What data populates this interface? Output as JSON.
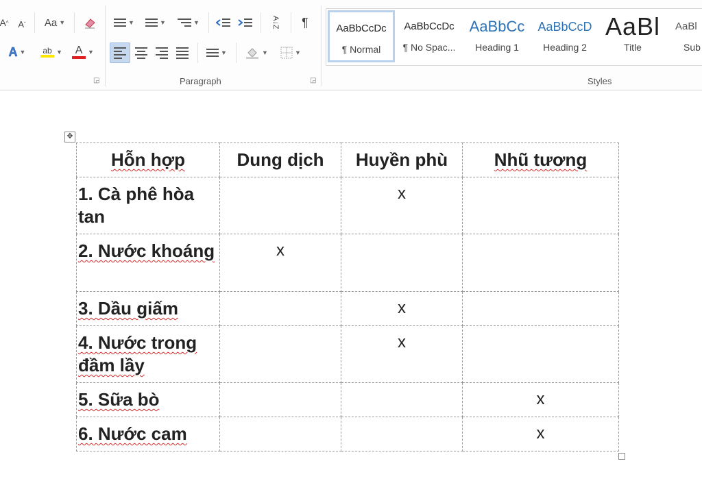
{
  "ribbon": {
    "font_case_label": "Aa",
    "paragraph_label": "Paragraph",
    "styles_label": "Styles",
    "pilcrow": "¶",
    "sort_label": "A↓Z",
    "styles": [
      {
        "preview": "AaBbCcDc",
        "name": "¶ Normal",
        "selected": true
      },
      {
        "preview": "AaBbCcDc",
        "name": "¶ No Spac...",
        "selected": false
      },
      {
        "preview": "AaBbCc",
        "name": "Heading 1",
        "selected": false
      },
      {
        "preview": "AaBbCcD",
        "name": "Heading 2",
        "selected": false
      },
      {
        "preview": "AaBl",
        "name": "Title",
        "selected": false
      },
      {
        "preview": "AaBl",
        "name": "Sub",
        "selected": false
      }
    ],
    "colors": {
      "highlight": "#ffe600",
      "font_color": "#e02020",
      "accent": "#2b579a"
    }
  },
  "table": {
    "headers": [
      "Hỗn hợp",
      "Dung dịch",
      "Huyền phù",
      "Nhũ tương"
    ],
    "rows": [
      {
        "name": "1. Cà phê hòa tan",
        "dung_dich": "",
        "huyen_phu": "x",
        "nhu_tuong": ""
      },
      {
        "name": "2. Nước khoáng",
        "dung_dich": "x",
        "huyen_phu": "",
        "nhu_tuong": ""
      },
      {
        "name": "3. Dầu giấm",
        "dung_dich": "",
        "huyen_phu": "x",
        "nhu_tuong": ""
      },
      {
        "name": "4. Nước trong đầm lầy",
        "dung_dich": "",
        "huyen_phu": "x",
        "nhu_tuong": ""
      },
      {
        "name": "5. Sữa bò",
        "dung_dich": "",
        "huyen_phu": "",
        "nhu_tuong": "x"
      },
      {
        "name": "6. Nước cam",
        "dung_dich": "",
        "huyen_phu": "",
        "nhu_tuong": "x"
      }
    ]
  }
}
